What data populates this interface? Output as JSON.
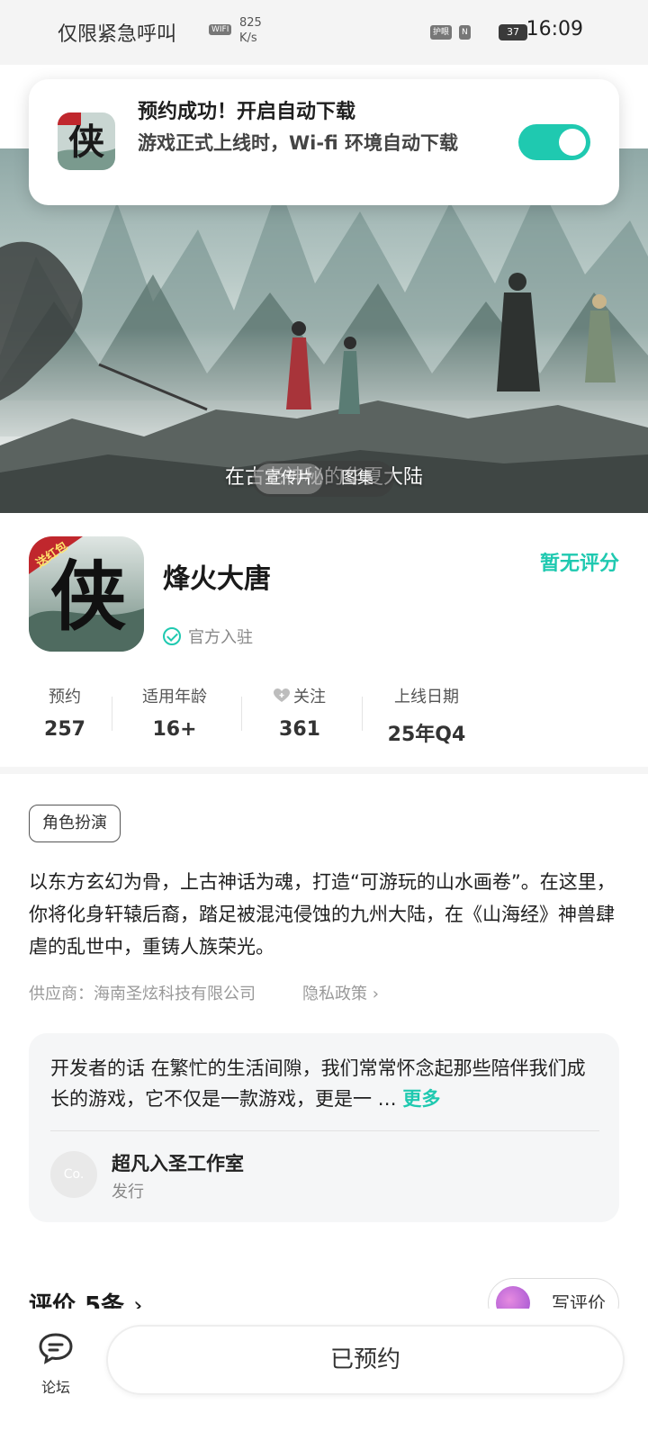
{
  "status_bar": {
    "carrier": "仅限紧急呼叫",
    "wifi_badge": "WIFI",
    "speed_value": "825",
    "speed_unit": "K/s",
    "badge1": "护眼",
    "badge2": "N",
    "battery": "37",
    "time": "16:09"
  },
  "notification": {
    "title": "预约成功！开启自动下载",
    "body": "游戏正式上线时，Wi-fi 环境自动下载",
    "toggle_on": true
  },
  "hero": {
    "caption": "在古老神秘的华夏大陆",
    "tabs": [
      "宣传片",
      "图集"
    ],
    "active_tab": 0
  },
  "app": {
    "name": "烽火大唐",
    "official": "官方入驻",
    "rating": "暂无评分",
    "icon_text": "侠",
    "icon_badge": "送红包"
  },
  "stats": [
    {
      "label": "预约",
      "value": "257"
    },
    {
      "label": "适用年龄",
      "value": "16+"
    },
    {
      "label": "关注",
      "value": "361"
    },
    {
      "label": "上线日期",
      "value": "25年Q4"
    }
  ],
  "detail": {
    "tag": "角色扮演",
    "description": "以东方玄幻为骨，上古神话为魂，打造“可游玩的山水画卷”。在这里，你将化身轩辕后裔，踏足被混沌侵蚀的九州大陆，在《山海经》神兽肆虐的乱世中，重铸人族荣光。",
    "supplier": "供应商：海南圣炫科技有限公司",
    "privacy": "隐私政策"
  },
  "developer": {
    "text": "开发者的话  在繁忙的生活间隙，我们常常怀念起那些陪伴我们成长的游戏，它不仅是一款游戏，更是一 …",
    "more": "更多",
    "avatar": "Co.",
    "name": "超凡入圣工作室",
    "role": "发行"
  },
  "reviews": {
    "title": "评价",
    "count": "5条",
    "chevron": "›",
    "write": "写评价"
  },
  "bottom": {
    "forum": "论坛",
    "reserve": "已预约"
  },
  "colors": {
    "accent": "#1fc9b0"
  }
}
